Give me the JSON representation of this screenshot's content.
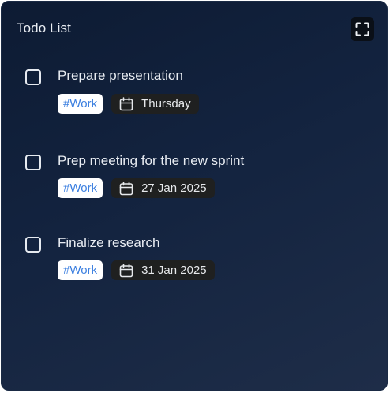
{
  "header": {
    "title": "Todo List",
    "expand_icon": "expand-icon"
  },
  "tasks": [
    {
      "title": "Prepare presentation",
      "tag": "#Work",
      "date": "Thursday",
      "checked": false
    },
    {
      "title": "Prep meeting for the new sprint",
      "tag": "#Work",
      "date": "27 Jan 2025",
      "checked": false
    },
    {
      "title": "Finalize research",
      "tag": "#Work",
      "date": "31 Jan 2025",
      "checked": false
    }
  ],
  "colors": {
    "tag_text": "#3b7fe0",
    "tag_bg": "#ffffff",
    "date_bg": "#1f2020",
    "panel_bg": "#13233f"
  }
}
